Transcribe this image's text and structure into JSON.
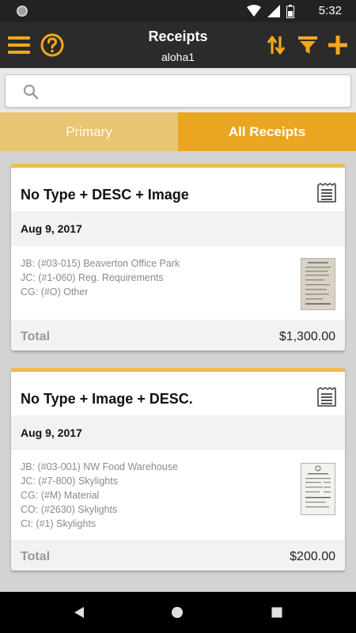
{
  "status_bar": {
    "time": "5:32"
  },
  "app_bar": {
    "title": "Receipts",
    "subtitle": "aloha1",
    "accent": "#f5a71c",
    "icons": [
      "menu-icon",
      "help-icon",
      "sort-icon",
      "filter-icon",
      "add-icon"
    ]
  },
  "search": {
    "placeholder": "",
    "value": ""
  },
  "tabs": [
    {
      "label": "Primary",
      "selected": false
    },
    {
      "label": "All Receipts",
      "selected": true
    }
  ],
  "receipts": [
    {
      "title": "No Type + DESC + Image",
      "date": "Aug 9, 2017",
      "details": [
        "JB: (#03-015) Beaverton Office Park",
        "JC: (#1-060) Reg. Requirements",
        "CG: (#O) Other"
      ],
      "total_label": "Total",
      "total": "$1,300.00"
    },
    {
      "title": "No Type + Image + DESC.",
      "date": "Aug 9, 2017",
      "details": [
        "JB: (#03-001) NW Food Warehouse",
        "JC: (#7-800) Skylights",
        "CG: (#M) Material",
        "CO: (#2630) Skylights",
        "CI: (#1) Skylights"
      ],
      "total_label": "Total",
      "total": "$200.00"
    }
  ]
}
